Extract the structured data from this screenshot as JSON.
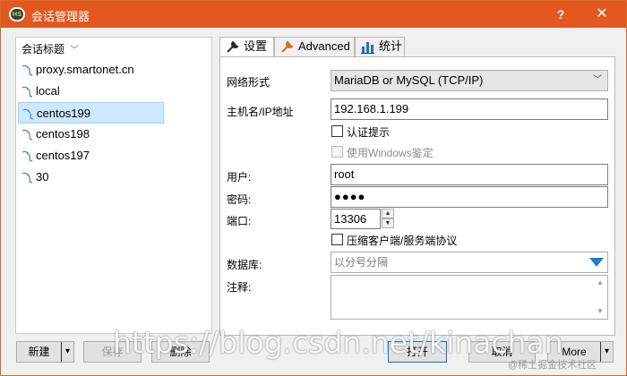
{
  "window": {
    "title": "会话管理器",
    "app_icon": "heidisql-logo",
    "app_icon_text": "HS",
    "help_label": "?",
    "close_label": "✕",
    "accent": "#e2581f"
  },
  "sessions": {
    "header": "会话标题",
    "items": [
      {
        "label": "proxy.smartonet.cn",
        "icon": "mysql-dolphin-icon",
        "selected": false
      },
      {
        "label": "local",
        "icon": "mysql-dolphin-icon",
        "selected": false
      },
      {
        "label": "centos199",
        "icon": "mysql-dolphin-icon",
        "selected": true
      },
      {
        "label": "centos198",
        "icon": "mysql-dolphin-icon",
        "selected": false
      },
      {
        "label": "centos197",
        "icon": "mysql-dolphin-icon",
        "selected": false
      },
      {
        "label": "30",
        "icon": "mysql-dolphin-icon",
        "selected": false
      }
    ]
  },
  "tabs": [
    {
      "label": "设置",
      "icon": "wrench-icon",
      "active": true
    },
    {
      "label": "Advanced",
      "icon": "wrench-orange-icon",
      "active": false
    },
    {
      "label": "统计",
      "icon": "bar-chart-icon",
      "active": false
    }
  ],
  "settings": {
    "network_type_label": "网络形式",
    "network_type_value": "MariaDB or MySQL (TCP/IP)",
    "host_label": "主机名/IP地址",
    "host_value": "192.168.1.199",
    "auth_prompt_label": "认证提示",
    "windows_auth_label": "使用Windows鉴定",
    "user_label": "用户:",
    "user_value": "root",
    "password_label": "密码:",
    "password_value": "●●●●",
    "port_label": "端口:",
    "port_value": "13306",
    "compress_label": "压缩客户端/服务端协议",
    "database_label": "数据库:",
    "database_placeholder": "以分号分隔",
    "comment_label": "注释:"
  },
  "buttons": {
    "new": "新建",
    "save": "保存",
    "delete": "删除",
    "open": "打开",
    "cancel": "取消",
    "more": "More"
  },
  "overlay": {
    "watermark_url": "https://blog.csdn.net/kinachan",
    "watermark_site": "@稀土掘金技术社区"
  }
}
